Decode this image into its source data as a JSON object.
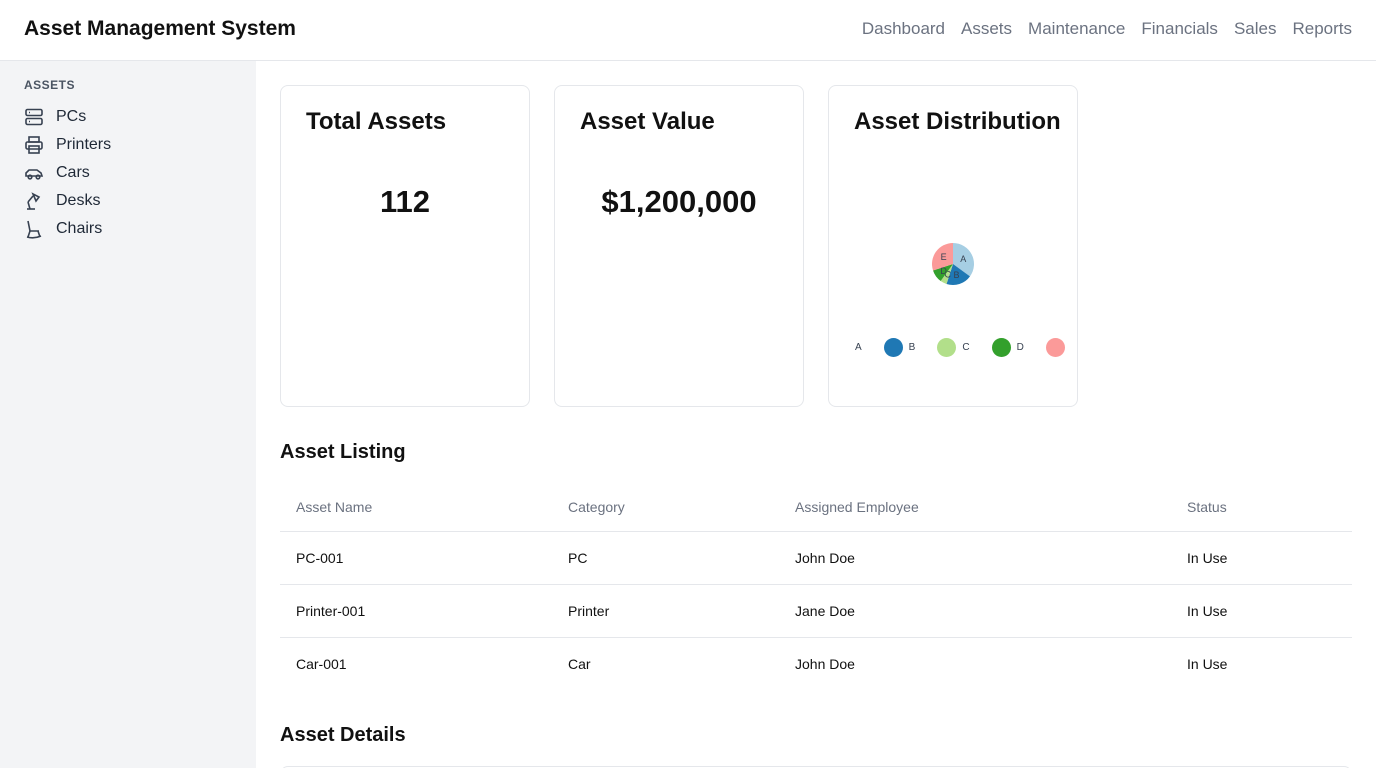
{
  "app": {
    "title": "Asset Management System"
  },
  "nav": [
    {
      "label": "Dashboard"
    },
    {
      "label": "Assets"
    },
    {
      "label": "Maintenance"
    },
    {
      "label": "Financials"
    },
    {
      "label": "Sales"
    },
    {
      "label": "Reports"
    }
  ],
  "sidebar": {
    "heading": "ASSETS",
    "items": [
      {
        "label": "PCs",
        "icon": "server-icon"
      },
      {
        "label": "Printers",
        "icon": "printer-icon"
      },
      {
        "label": "Cars",
        "icon": "car-icon"
      },
      {
        "label": "Desks",
        "icon": "desk-lamp-icon"
      },
      {
        "label": "Chairs",
        "icon": "chair-icon"
      }
    ]
  },
  "cards": {
    "total_assets": {
      "title": "Total Assets",
      "value": "112"
    },
    "asset_value": {
      "title": "Asset Value",
      "value": "$1,200,000"
    },
    "distribution": {
      "title": "Asset Distribution"
    }
  },
  "chart_data": {
    "type": "pie",
    "categories": [
      "A",
      "B",
      "C",
      "D",
      "E"
    ],
    "values": [
      35,
      20,
      5,
      10,
      30
    ],
    "colors": [
      "#a6cee3",
      "#1f78b4",
      "#b2df8a",
      "#33a02c",
      "#fb9a99"
    ],
    "legend_labels": [
      "A",
      "B",
      "C",
      "D"
    ],
    "legend_placement": "bottom"
  },
  "listing": {
    "title": "Asset Listing",
    "columns": [
      "Asset Name",
      "Category",
      "Assigned Employee",
      "Status"
    ],
    "rows": [
      [
        "PC-001",
        "PC",
        "John Doe",
        "In Use"
      ],
      [
        "Printer-001",
        "Printer",
        "Jane Doe",
        "In Use"
      ],
      [
        "Car-001",
        "Car",
        "John Doe",
        "In Use"
      ]
    ]
  },
  "details": {
    "title": "Asset Details"
  }
}
